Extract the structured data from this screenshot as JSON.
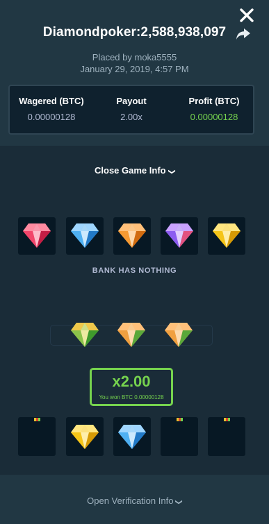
{
  "header": {
    "title": "Diamondpoker:2,588,938,097",
    "placed_by": "Placed by moka5555",
    "date": "January 29, 2019, 4:57 PM"
  },
  "stats": {
    "wagered_label": "Wagered (BTC)",
    "wagered_value": "0.00000128",
    "payout_label": "Payout",
    "payout_value": "2.00x",
    "profit_label": "Profit (BTC)",
    "profit_value": "0.00000128"
  },
  "game_info": {
    "label": "Close Game Info"
  },
  "bank": {
    "gems": [
      "red",
      "blue",
      "orange",
      "purple",
      "yellow"
    ],
    "label": "BANK HAS NOTHING"
  },
  "hand": {
    "gems": [
      "green",
      "orange-green",
      "orange-green"
    ]
  },
  "win": {
    "multiplier": "x2.00",
    "message": "You won BTC 0.00000128"
  },
  "cards": {
    "items": [
      "hidden",
      "yellow",
      "blue",
      "hidden",
      "hidden"
    ]
  },
  "footer": {
    "verify_label": "Open Verification Info"
  },
  "icons": {
    "close": "close-icon",
    "share": "share-icon",
    "chevron": "chevron-down-icon"
  },
  "colors": {
    "background": "#1a2c38",
    "panel": "#213743",
    "tile": "#071824",
    "accent_green": "#76d34e",
    "muted": "#9fb2bf"
  }
}
